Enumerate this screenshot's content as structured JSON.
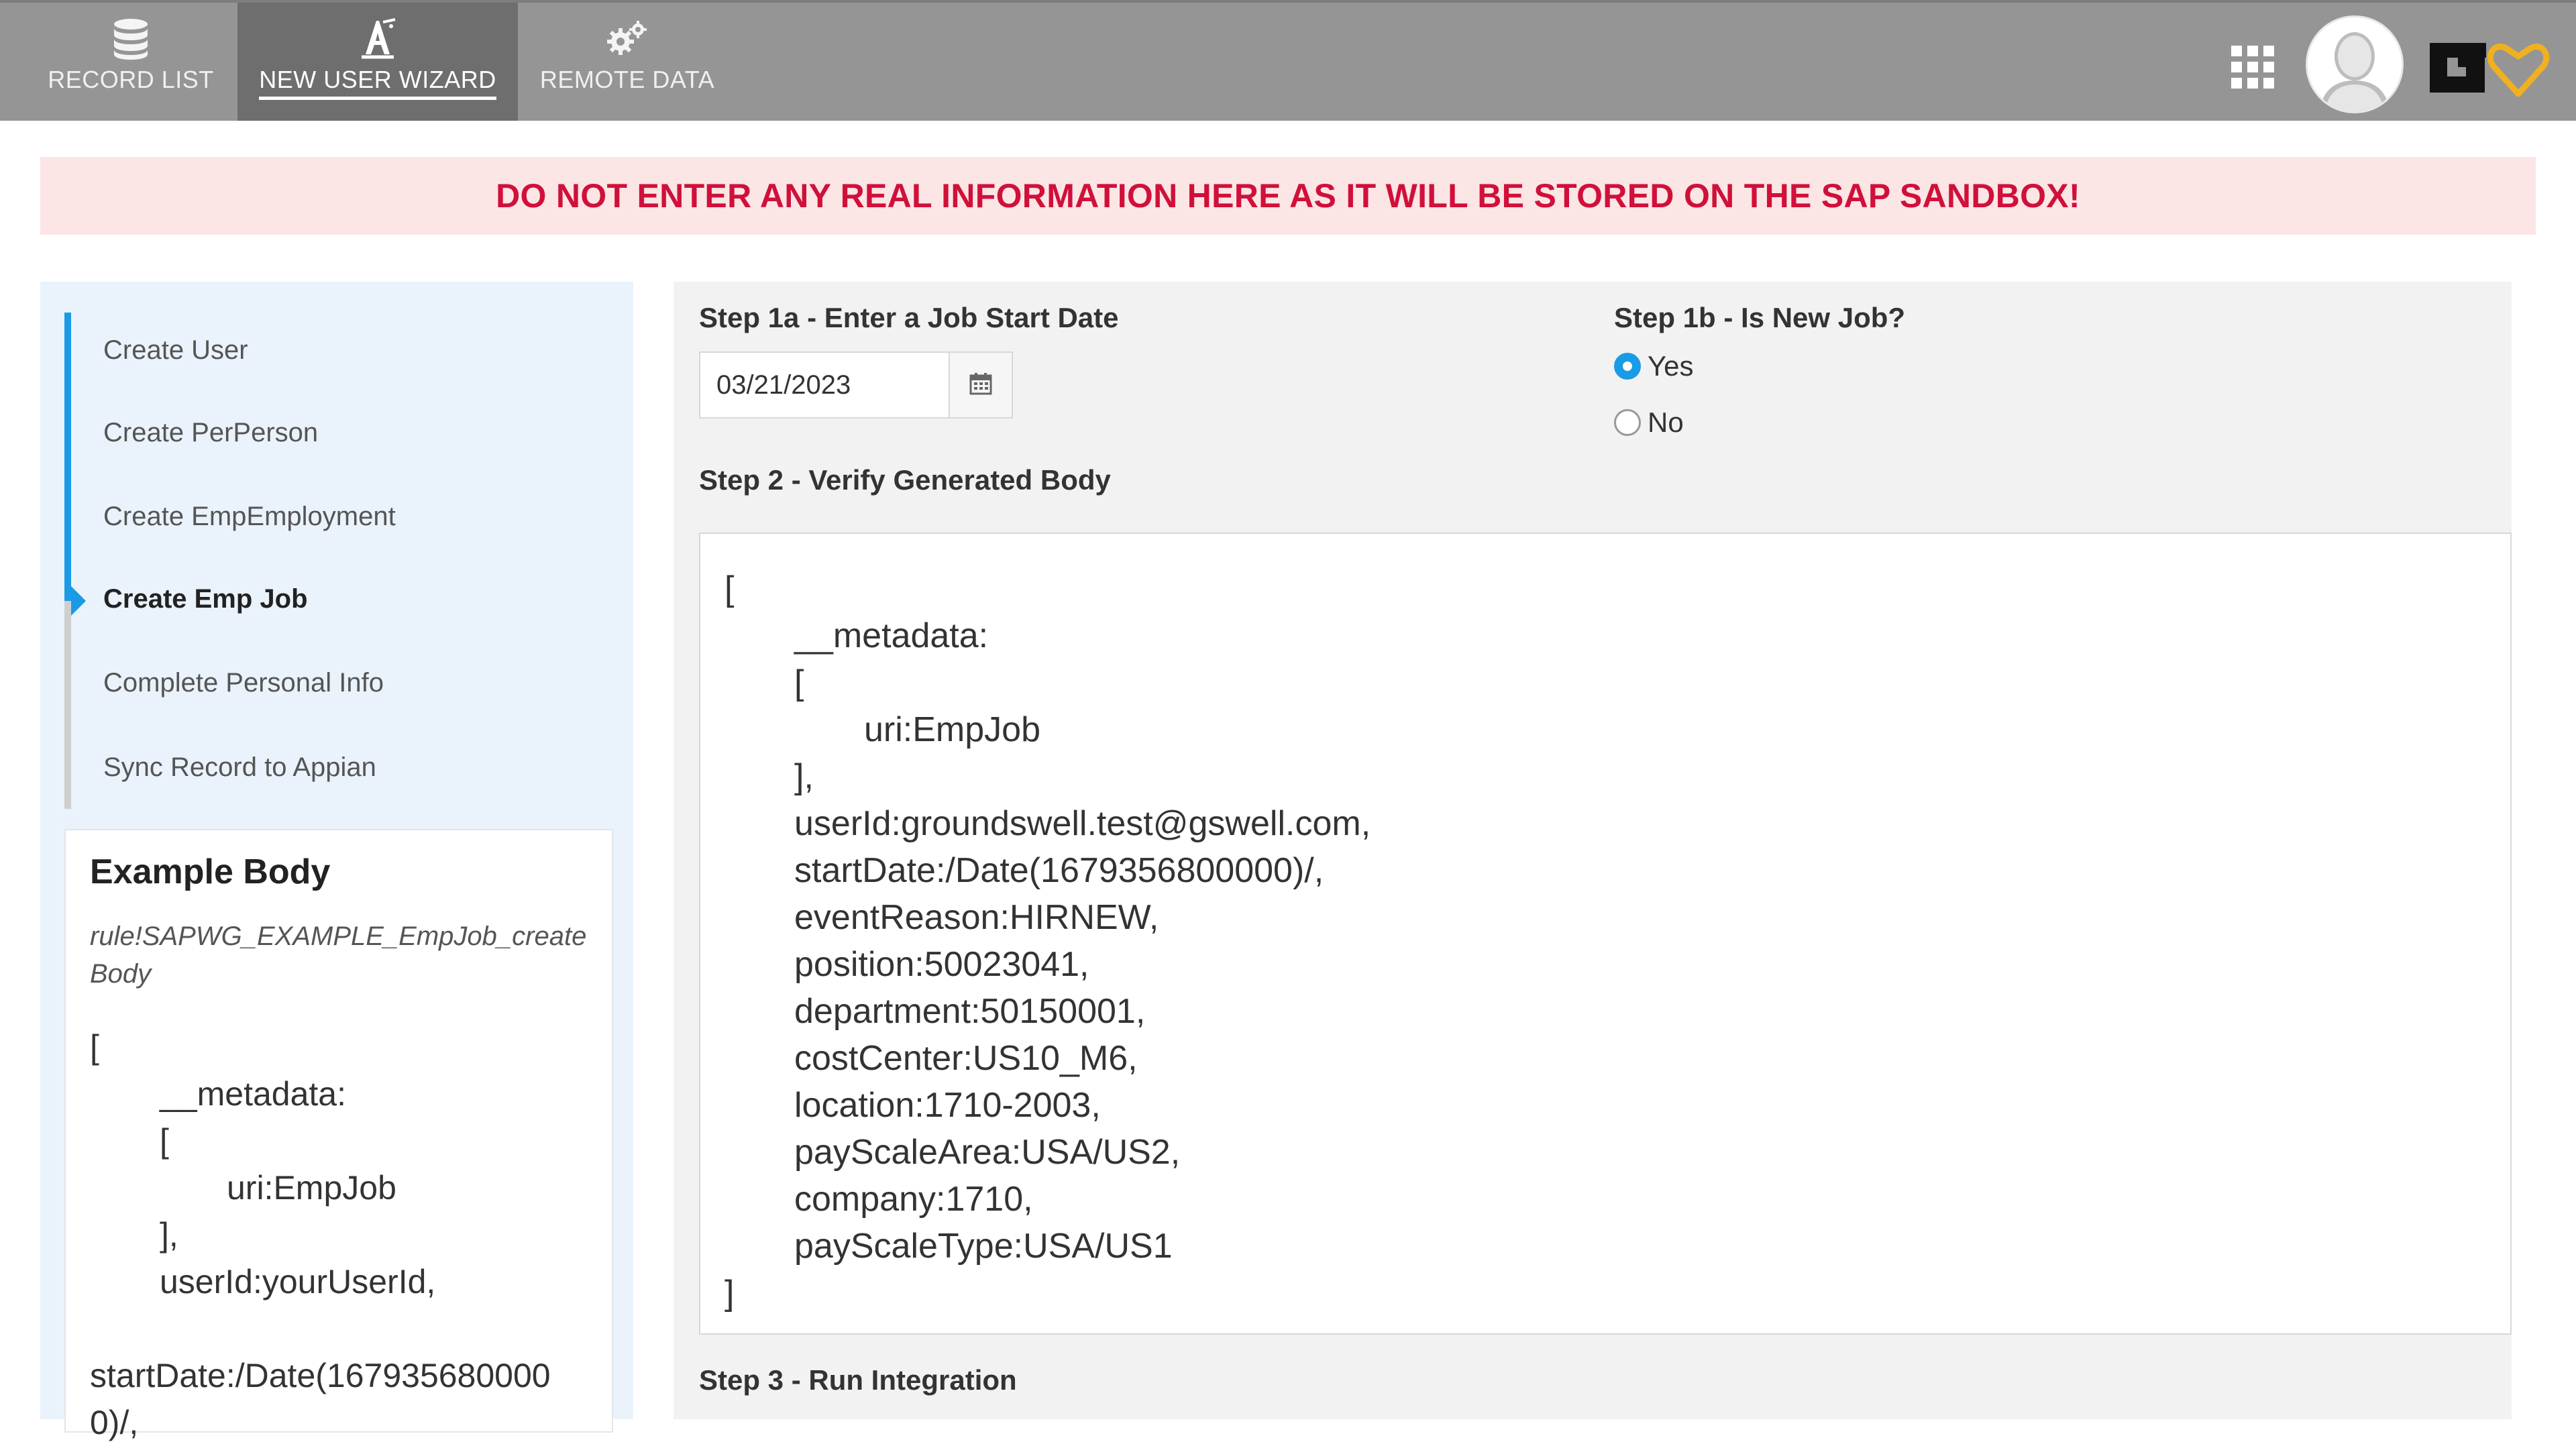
{
  "nav": {
    "tabs": [
      {
        "label": "RECORD LIST",
        "icon": "database-icon"
      },
      {
        "label": "NEW USER WIZARD",
        "icon": "wizard-icon",
        "active": true
      },
      {
        "label": "REMOTE DATA",
        "icon": "gears-icon"
      }
    ]
  },
  "banner": {
    "text": "DO NOT ENTER ANY REAL INFORMATION HERE AS IT WILL BE STORED ON THE SAP SANDBOX!",
    "color": "#d0103a"
  },
  "steps": {
    "items": [
      {
        "label": "Create User",
        "status": "done"
      },
      {
        "label": "Create PerPerson",
        "status": "done"
      },
      {
        "label": "Create EmpEmployment",
        "status": "done"
      },
      {
        "label": "Create Emp Job",
        "status": "current"
      },
      {
        "label": "Complete Personal Info",
        "status": "pending"
      },
      {
        "label": "Sync Record to Appian",
        "status": "pending"
      }
    ],
    "accent": "#1a9be6"
  },
  "example": {
    "title": "Example Body",
    "rule": "rule!SAPWG_EXAMPLE_EmpJob_createBody",
    "rule_line1": "rule!SAPWG_EXAMPLE_EmpJob_create",
    "rule_line2": "Body",
    "lines": [
      "[",
      "__metadata:",
      "[",
      "uri:EmpJob",
      "],",
      "userId:yourUserId,",
      "startDate:/Date(167935680000",
      "0)/,"
    ]
  },
  "main": {
    "step1a_label": "Step 1a - Enter a Job Start Date",
    "start_date": "03/21/2023",
    "step1b_label": "Step 1b - Is New Job?",
    "options": [
      "Yes",
      "No"
    ],
    "selected": "Yes",
    "step2_label": "Step 2 - Verify Generated Body",
    "body_lines": [
      "[",
      "__metadata:",
      "[",
      "uri:EmpJob",
      "],",
      "userId:groundswell.test@gswell.com,",
      "startDate:/Date(1679356800000)/,",
      "eventReason:HIRNEW,",
      "position:50023041,",
      "department:50150001,",
      "costCenter:US10_M6,",
      "location:1710-2003,",
      "payScaleArea:USA/US2,",
      "company:1710,",
      "payScaleType:USA/US1",
      "]"
    ],
    "step3_label": "Step 3 - Run Integration"
  }
}
